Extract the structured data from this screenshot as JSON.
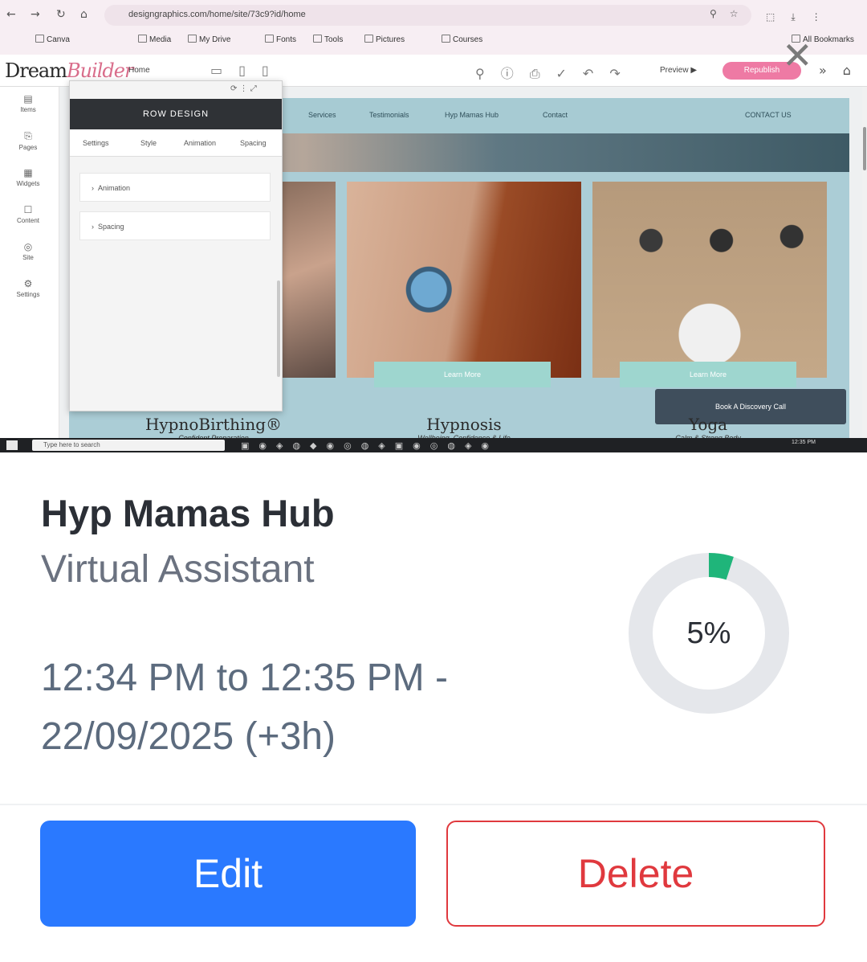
{
  "screenshot": {
    "browser": {
      "url": "designgraphics.com/home/site/73c9?id/home",
      "bookmarks": [
        "Canva",
        "Media",
        "My Drive",
        "Fonts",
        "Tools",
        "Pictures",
        "Courses",
        "All Bookmarks"
      ],
      "nav_back": "←",
      "nav_forward": "→",
      "nav_reload": "↻",
      "nav_home": "⌂",
      "addr_icons": "⚲☆",
      "right_icons": "⬚⤓⋮"
    },
    "builder": {
      "logo_prefix": "Dream",
      "logo_suffix": "Builder",
      "page_select": "Home",
      "view_icons": "▭▯▯",
      "tool_icons": "⚲ⓘ⎙✓↶↷",
      "preview_label": "Preview ▶",
      "publish_label": "Republish",
      "close_icon": "✕",
      "right_icons": "»⌂"
    },
    "left_rail": [
      {
        "icon": "▤",
        "label": "Items"
      },
      {
        "icon": "⎘",
        "label": "Pages"
      },
      {
        "icon": "▦",
        "label": "Widgets"
      },
      {
        "icon": "☐",
        "label": "Content"
      },
      {
        "icon": "◎",
        "label": "Site"
      },
      {
        "icon": "⚙",
        "label": "Settings"
      }
    ],
    "site_nav": [
      "Services",
      "Testimonials",
      "Hyp Mamas Hub",
      "Contact",
      "CONTACT US"
    ],
    "panel": {
      "top_icons": "⟳ ⋮ ⤢",
      "header": "ROW DESIGN",
      "tabs": [
        "Settings",
        "Style",
        "Animation",
        "Spacing"
      ],
      "accordions": [
        "Animation",
        "Spacing"
      ]
    },
    "learn_more": "Learn More",
    "book_call": "Book A Discovery Call",
    "services": [
      {
        "title": "HypnoBirthing®",
        "subtitle": "Confident Preparation"
      },
      {
        "title": "Hypnosis",
        "subtitle": "Wellbeing, Confidence & Life"
      },
      {
        "title": "Yoga",
        "subtitle": "Calm & Strong Body"
      }
    ],
    "taskbar": {
      "search": "Type here to search",
      "icons": "▣◉◈◍◆◉◎◍◈▣◉◎◍◈◉",
      "time": "12:35 PM"
    }
  },
  "card": {
    "title": "Hyp Mamas Hub",
    "subtitle": "Virtual Assistant",
    "time_range": "12:34 PM to 12:35 PM - 22/09/2025 (+3h)",
    "progress_label": "5%",
    "progress_value": 5,
    "colors": {
      "track": "#e5e7eb",
      "fill": "#1fb57a",
      "edit": "#2a79ff",
      "delete": "#e0393e"
    },
    "edit_label": "Edit",
    "delete_label": "Delete"
  }
}
